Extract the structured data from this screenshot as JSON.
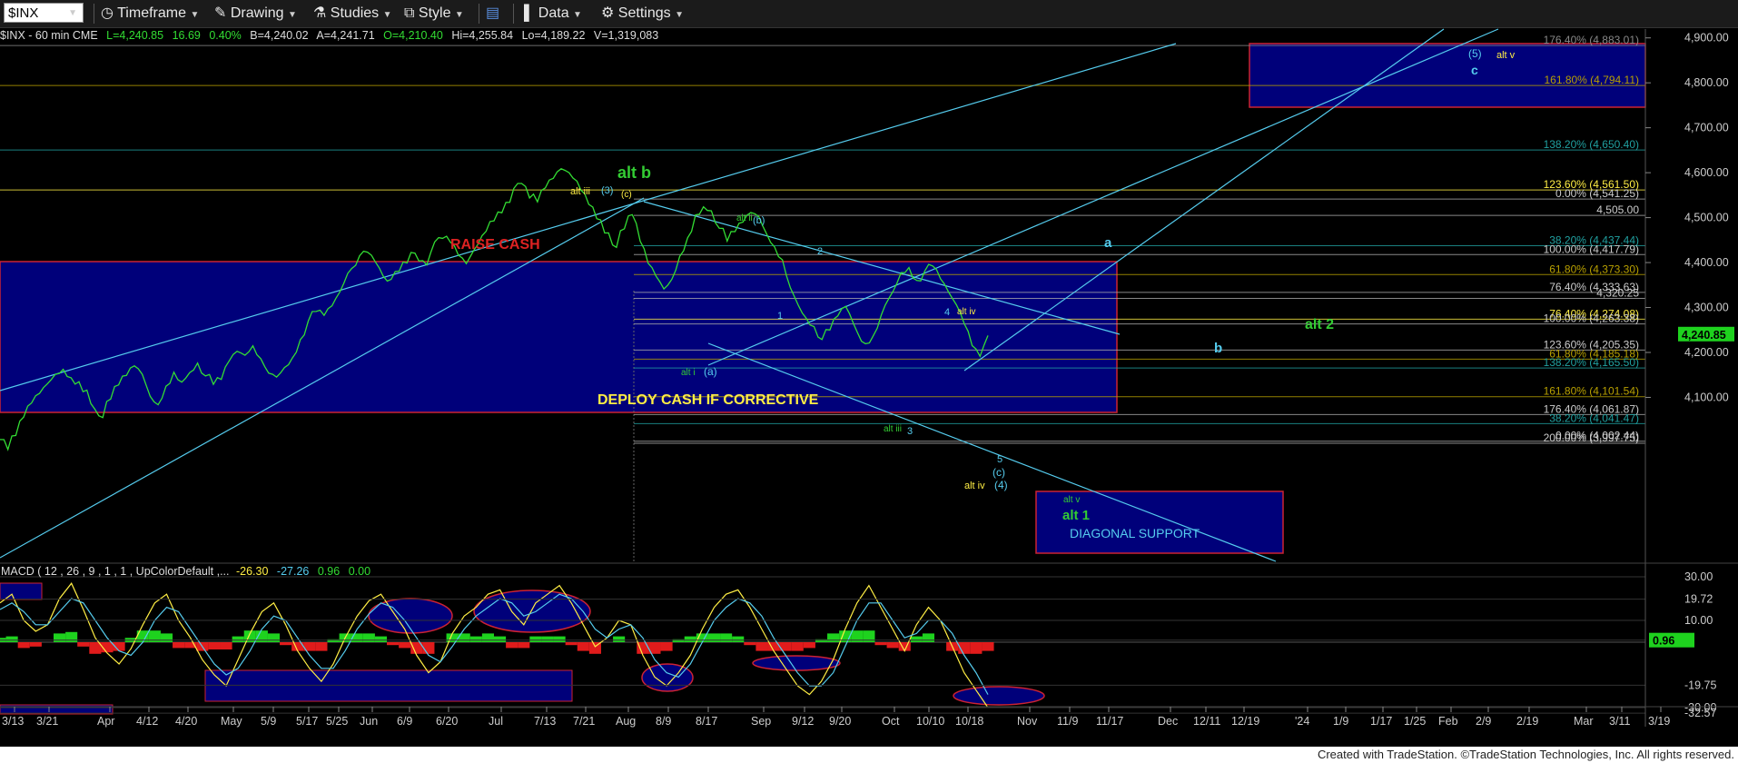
{
  "toolbar": {
    "symbol": "$INX",
    "timeframe": "Timeframe",
    "drawing": "Drawing",
    "studies": "Studies",
    "style": "Style",
    "data": "Data",
    "settings": "Settings"
  },
  "infobar": {
    "symbol": "$INX - 60 min  CME",
    "last": "L=4,240.85",
    "change": "16.69",
    "pct": "0.40%",
    "bid": "B=4,240.02",
    "ask": "A=4,241.71",
    "open": "O=4,210.40",
    "high": "Hi=4,255.84",
    "low": "Lo=4,189.22",
    "volume": "V=1,319,083"
  },
  "macd_header": {
    "label": "MACD ( 12 , 26 , 9 , 1 , 1 , UpColorDefault ,...",
    "v1": "-26.30",
    "v2": "-27.26",
    "v3": "0.96",
    "v4": "0.00"
  },
  "footer": "Created with TradeStation. ©TradeStation Technologies, Inc. All rights reserved.",
  "colors": {
    "price": "#33dd33",
    "band": "#00007a",
    "cyan": "#55ccee",
    "yellow": "#ffee44",
    "green_label": "#33cc33",
    "red": "#dd2222",
    "last_price_bg": "#1ed21e"
  },
  "chart_data": [
    {
      "type": "line",
      "title": "$INX - 60 min",
      "price_scale": {
        "ylim": [
          3940,
          4920
        ],
        "ticks": [
          "4,100.00",
          "4,200.00",
          "4,300.00",
          "4,400.00",
          "4,500.00",
          "4,600.00",
          "4,700.00",
          "4,800.00",
          "4,900.00"
        ],
        "last_price_label": "4,240.85"
      },
      "x_tick_labels": [
        "3/13",
        "3/21",
        "Apr",
        "4/12",
        "4/20",
        "May",
        "5/9",
        "5/17",
        "5/25",
        "Jun",
        "6/9",
        "6/20",
        "Jul",
        "7/13",
        "7/21",
        "Aug",
        "8/9",
        "8/17",
        "Sep",
        "9/12",
        "9/20",
        "Oct",
        "10/10",
        "10/18",
        "Nov",
        "11/9",
        "11/17",
        "Dec",
        "12/11",
        "12/19",
        "'24",
        "1/9",
        "1/17",
        "1/25",
        "Feb",
        "2/9",
        "2/19",
        "Mar",
        "3/11",
        "3/19"
      ],
      "series": [
        {
          "values": [
            4000,
            3990,
            4020,
            4060,
            4090,
            4110,
            4130,
            4150,
            4160,
            4140,
            4130,
            4110,
            4080,
            4060,
            4100,
            4130,
            4150,
            4170,
            4150,
            4100,
            4080,
            4120,
            4150,
            4140,
            4160,
            4180,
            4150,
            4130,
            4140,
            4180,
            4200,
            4190,
            4210,
            4180,
            4160,
            4150,
            4170,
            4190,
            4230,
            4270,
            4290,
            4280,
            4300,
            4330,
            4370,
            4400,
            4430,
            4420,
            4390,
            4360,
            4380,
            4400,
            4420,
            4400,
            4390,
            4440,
            4460,
            4450,
            4420,
            4400,
            4430,
            4460,
            4490,
            4510,
            4530,
            4560,
            4570,
            4550,
            4540,
            4570,
            4590,
            4610,
            4600,
            4580,
            4550,
            4520,
            4490,
            4460,
            4440,
            4480,
            4510,
            4450,
            4400,
            4370,
            4340,
            4360,
            4410,
            4450,
            4500,
            4530,
            4520,
            4480,
            4450,
            4470,
            4490,
            4510,
            4500,
            4460,
            4430,
            4400,
            4350,
            4310,
            4280,
            4260,
            4230,
            4250,
            4280,
            4300,
            4260,
            4220,
            4215,
            4260,
            4310,
            4340,
            4380,
            4390,
            4360,
            4380,
            4390,
            4360,
            4330,
            4300,
            4270,
            4220,
            4195,
            4240
          ]
        }
      ],
      "fib_levels": [
        {
          "label": "176.40% (4,883.01)",
          "value": 4883.01,
          "color": "#888888"
        },
        {
          "label": "161.80% (4,794.11)",
          "value": 4794.11,
          "color": "#b8a000"
        },
        {
          "label": "138.20% (4,650.40)",
          "value": 4650.4,
          "color": "#20a0a0"
        },
        {
          "label": "123.60% (4,561.50)",
          "value": 4561.5,
          "color": "#ffee44"
        },
        {
          "label": "0.00% (4,541.25)",
          "value": 4541.25,
          "color": "#aaaaaa"
        },
        {
          "label": "4,505.00",
          "value": 4505.0,
          "color": "#aaaaaa"
        },
        {
          "label": "38.20% (4,437.44)",
          "value": 4437.44,
          "color": "#20a0a0"
        },
        {
          "label": "100.00% (4,417.79)",
          "value": 4417.79,
          "color": "#aaaaaa"
        },
        {
          "label": "61.80% (4,373.30)",
          "value": 4373.3,
          "color": "#b8a000"
        },
        {
          "label": "76.40% (4,333.63)",
          "value": 4333.63,
          "color": "#aaaaaa"
        },
        {
          "label": "4,320.25",
          "value": 4320.25,
          "color": "#aaaaaa"
        },
        {
          "label": "76.40% (4,274.08)",
          "value": 4274.08,
          "color": "#ffee44"
        },
        {
          "label": "100.00% (4,263.38)",
          "value": 4263.38,
          "color": "#aaaaaa"
        },
        {
          "label": "123.60% (4,205.35)",
          "value": 4205.35,
          "color": "#aaaaaa"
        },
        {
          "label": "61.80% (4,185.18)",
          "value": 4185.18,
          "color": "#b8a000"
        },
        {
          "label": "138.20% (4,165.50)",
          "value": 4165.5,
          "color": "#20a0a0"
        },
        {
          "label": "161.80% (4,101.54)",
          "value": 4101.54,
          "color": "#b8a000"
        },
        {
          "label": "176.40% (4,061.87)",
          "value": 4061.87,
          "color": "#aaaaaa"
        },
        {
          "label": "38.20% (4,041.47)",
          "value": 4041.47,
          "color": "#20a0a0"
        },
        {
          "label": "0.00% (4,002.44)",
          "value": 4002.44,
          "color": "#aaaaaa"
        },
        {
          "label": "200.00% (3,997.75)",
          "value": 3997.75,
          "color": "#aaaaaa"
        }
      ],
      "annotations": [
        {
          "text": "RAISE CASH",
          "color": "#dd2222"
        },
        {
          "text": "DEPLOY CASH IF CORRECTIVE",
          "color": "#ffee44"
        },
        {
          "text": "DIAGONAL SUPPORT",
          "color": "#55ccee"
        },
        {
          "text": "alt b",
          "color": "#33cc33"
        },
        {
          "text": "alt 2",
          "color": "#33cc33"
        },
        {
          "text": "alt 1",
          "color": "#33cc33"
        },
        {
          "text": "a",
          "color": "#55ccee"
        },
        {
          "text": "b",
          "color": "#55ccee"
        },
        {
          "text": "c",
          "color": "#55ccee"
        },
        {
          "text": "(5)",
          "color": "#55ccee"
        },
        {
          "text": "alt v",
          "color": "#ffee44"
        },
        {
          "text": "alt iii",
          "color": "#ffee44"
        },
        {
          "text": "(3)",
          "color": "#55ccee"
        },
        {
          "text": "(c)",
          "color": "#ffee44"
        },
        {
          "text": "alt ii",
          "color": "#33cc33"
        },
        {
          "text": "(b)",
          "color": "#55ccee"
        },
        {
          "text": "2",
          "color": "#55ccee"
        },
        {
          "text": "1",
          "color": "#55ccee"
        },
        {
          "text": "alt i",
          "color": "#33cc33"
        },
        {
          "text": "(a)",
          "color": "#55ccee"
        },
        {
          "text": "4",
          "color": "#55ccee"
        },
        {
          "text": "alt iv",
          "color": "#ffee44"
        },
        {
          "text": "alt iii",
          "color": "#33cc33"
        },
        {
          "text": "3",
          "color": "#55ccee"
        },
        {
          "text": "5",
          "color": "#55ccee"
        },
        {
          "text": "(c)",
          "color": "#55ccee"
        },
        {
          "text": "alt iv",
          "color": "#ffee44"
        },
        {
          "text": "(4)",
          "color": "#55ccee"
        },
        {
          "text": "alt v",
          "color": "#33cc33"
        }
      ]
    },
    {
      "type": "bar",
      "title": "MACD ( 12 , 26 , 9 , 1 , 1 , UpColorDefault ,...",
      "ylim": [
        -36,
        33
      ],
      "price_scale_ticks": [
        "30.00",
        "19.72",
        "10.00",
        "0.96",
        "-19.75",
        "-32.57",
        "-30.00"
      ],
      "series": [
        {
          "name": "MACD",
          "values": [
            18,
            22,
            10,
            5,
            8,
            20,
            27,
            15,
            2,
            -5,
            -10,
            -3,
            8,
            18,
            22,
            10,
            2,
            -8,
            -15,
            -20,
            -8,
            4,
            14,
            18,
            8,
            -4,
            -12,
            -18,
            -10,
            2,
            12,
            19,
            22,
            14,
            6,
            -6,
            -14,
            -9,
            4,
            12,
            16,
            22,
            24,
            14,
            8,
            18,
            22,
            26,
            18,
            8,
            -2,
            2,
            10,
            8,
            -6,
            -16,
            -20,
            -14,
            -6,
            6,
            16,
            22,
            24,
            16,
            6,
            -4,
            -12,
            -20,
            -24,
            -18,
            -8,
            6,
            18,
            26,
            16,
            6,
            -4,
            8,
            16,
            10,
            -2,
            -14,
            -22,
            -30
          ]
        },
        {
          "name": "Signal",
          "values": [
            15,
            18,
            14,
            8,
            8,
            14,
            20,
            18,
            10,
            2,
            -4,
            -6,
            0,
            10,
            16,
            14,
            6,
            -2,
            -10,
            -15,
            -12,
            -4,
            6,
            12,
            10,
            2,
            -6,
            -12,
            -12,
            -4,
            6,
            13,
            18,
            16,
            10,
            2,
            -6,
            -9,
            -2,
            6,
            12,
            16,
            20,
            18,
            12,
            14,
            18,
            22,
            20,
            14,
            6,
            2,
            6,
            8,
            2,
            -8,
            -14,
            -16,
            -10,
            0,
            10,
            16,
            20,
            18,
            12,
            2,
            -6,
            -14,
            -20,
            -20,
            -14,
            -2,
            10,
            18,
            18,
            10,
            2,
            4,
            10,
            10,
            4,
            -6,
            -14,
            -24
          ]
        }
      ]
    }
  ]
}
